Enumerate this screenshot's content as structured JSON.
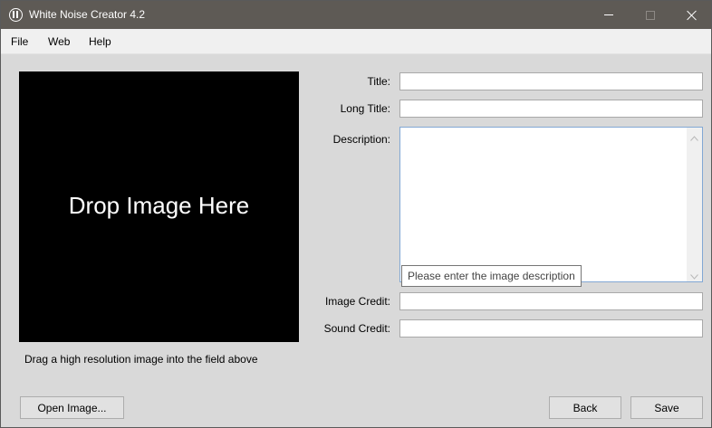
{
  "window": {
    "title": "White Noise Creator 4.2"
  },
  "menu": {
    "file": "File",
    "web": "Web",
    "help": "Help"
  },
  "image_panel": {
    "drop_text": "Drop Image Here",
    "hint": "Drag a high resolution image into the field above"
  },
  "form": {
    "title_label": "Title:",
    "title_value": "",
    "long_title_label": "Long Title:",
    "long_title_value": "",
    "description_label": "Description:",
    "description_value": "",
    "description_tooltip": "Please enter the image description",
    "image_credit_label": "Image Credit:",
    "image_credit_value": "",
    "sound_credit_label": "Sound Credit:",
    "sound_credit_value": ""
  },
  "buttons": {
    "open_image": "Open Image...",
    "back": "Back",
    "save": "Save"
  },
  "colors": {
    "titlebar": "#5e5a55",
    "window_bg": "#d9d9d9",
    "drop_zone_bg": "#000000",
    "focus_border": "#82a8d4"
  },
  "icons": {
    "app": "headphones-icon",
    "minimize": "minimize-icon",
    "maximize": "maximize-icon",
    "close": "close-icon"
  }
}
